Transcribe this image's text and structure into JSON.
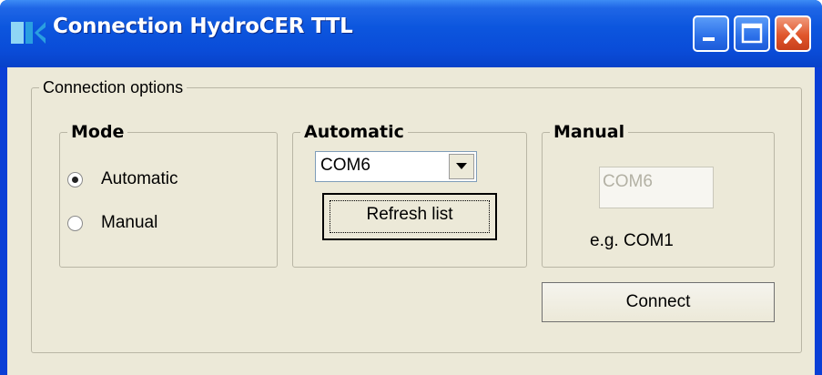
{
  "window": {
    "title": "Connection HydroCER TTL",
    "colors": {
      "titlebar": "#0a4cd8",
      "client": "#ece9d8",
      "close": "#e0562c"
    }
  },
  "title_buttons": [
    {
      "name": "minimize-button",
      "icon": "minimize-icon"
    },
    {
      "name": "maximize-button",
      "icon": "maximize-icon"
    },
    {
      "name": "close-button",
      "icon": "close-icon"
    }
  ],
  "connection_options": {
    "legend": "Connection options",
    "mode": {
      "legend": "Mode",
      "options": [
        {
          "label": "Automatic",
          "checked": true
        },
        {
          "label": "Manual",
          "checked": false
        }
      ]
    },
    "automatic": {
      "legend": "Automatic",
      "port_value": "COM6",
      "refresh_label": "Refresh list"
    },
    "manual": {
      "legend": "Manual",
      "port_value": "COM6",
      "hint": "e.g. COM1"
    },
    "connect_label": "Connect"
  }
}
